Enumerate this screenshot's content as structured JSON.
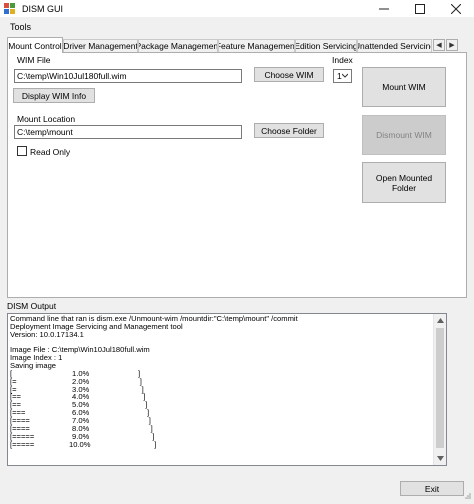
{
  "window": {
    "title": "DISM GUI"
  },
  "menu": [
    "Tools"
  ],
  "tabs": [
    "Mount Control",
    "Driver Management",
    "Package Management",
    "Feature Management",
    "Edition Servicing",
    "Unattended Servicing"
  ],
  "tab_scroll": {
    "left": "◀",
    "right": "▶"
  },
  "mount": {
    "wim_file_label": "WIM File",
    "wim_file_value": "C:\\temp\\Win10Jul180full.wim",
    "choose_wim_label": "Choose WIM",
    "index_label": "Index",
    "index_value": "1",
    "display_wim_info_label": "Display WIM Info",
    "mount_location_label": "Mount Location",
    "mount_location_value": "C:\\temp\\mount",
    "choose_folder_label": "Choose Folder",
    "read_only_label": "Read Only",
    "read_only_checked": false,
    "mount_wim_label": "Mount WIM",
    "dismount_wim_label": "Dismount WIM",
    "open_mounted_folder_label": "Open Mounted Folder"
  },
  "output": {
    "label": "DISM Output",
    "lines": [
      "Command line that ran is dism.exe /Unmount-wim /mountdir:\"C:\\temp\\mount\" /commit",
      "Deployment Image Servicing and Management tool",
      "Version: 10.0.17134.1",
      "",
      "Image File : C:\\temp\\Win10Jul180full.wim",
      "Image Index : 1",
      "Saving image"
    ],
    "progress": [
      {
        "bar": "[",
        "pct": "1.0%"
      },
      {
        "bar": "[=",
        "pct": "2.0%"
      },
      {
        "bar": "[=",
        "pct": "3.0%"
      },
      {
        "bar": "[==",
        "pct": "4.0%"
      },
      {
        "bar": "[==",
        "pct": "5.0%"
      },
      {
        "bar": "[===",
        "pct": "6.0%"
      },
      {
        "bar": "[====",
        "pct": "7.0%"
      },
      {
        "bar": "[====",
        "pct": "8.0%"
      },
      {
        "bar": "[=====",
        "pct": "9.0%"
      },
      {
        "bar": "[=====",
        "pct": "10.0%"
      }
    ],
    "bar_end": "]"
  },
  "exit_label": "Exit"
}
